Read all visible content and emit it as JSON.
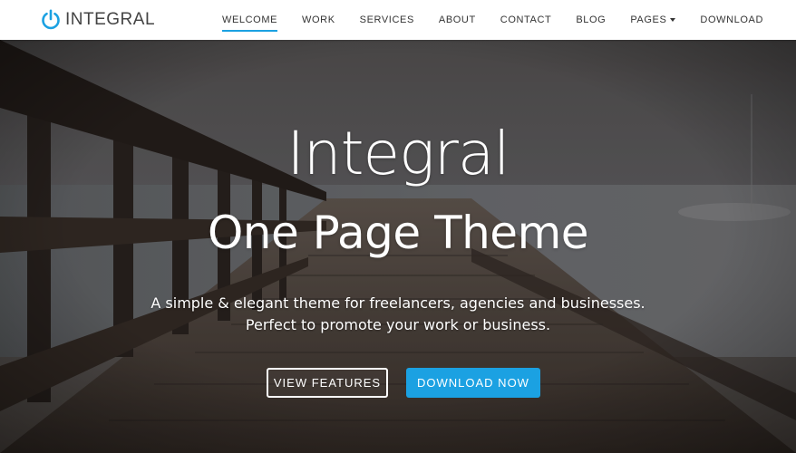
{
  "brand": {
    "name": "INTEGRAL",
    "logo_icon": "power-icon",
    "accent_color": "#1ba1e2"
  },
  "nav": {
    "items": [
      {
        "label": "WELCOME",
        "active": true
      },
      {
        "label": "WORK"
      },
      {
        "label": "SERVICES"
      },
      {
        "label": "ABOUT"
      },
      {
        "label": "CONTACT"
      },
      {
        "label": "BLOG"
      },
      {
        "label": "PAGES",
        "has_dropdown": true
      },
      {
        "label": "DOWNLOAD"
      }
    ]
  },
  "hero": {
    "title": "Integral",
    "subtitle": "One Page Theme",
    "description_line1": "A simple & elegant theme for freelancers, agencies and businesses.",
    "description_line2": "Perfect to promote your work or business.",
    "btn_features": "VIEW FEATURES",
    "btn_download": "DOWNLOAD NOW"
  }
}
